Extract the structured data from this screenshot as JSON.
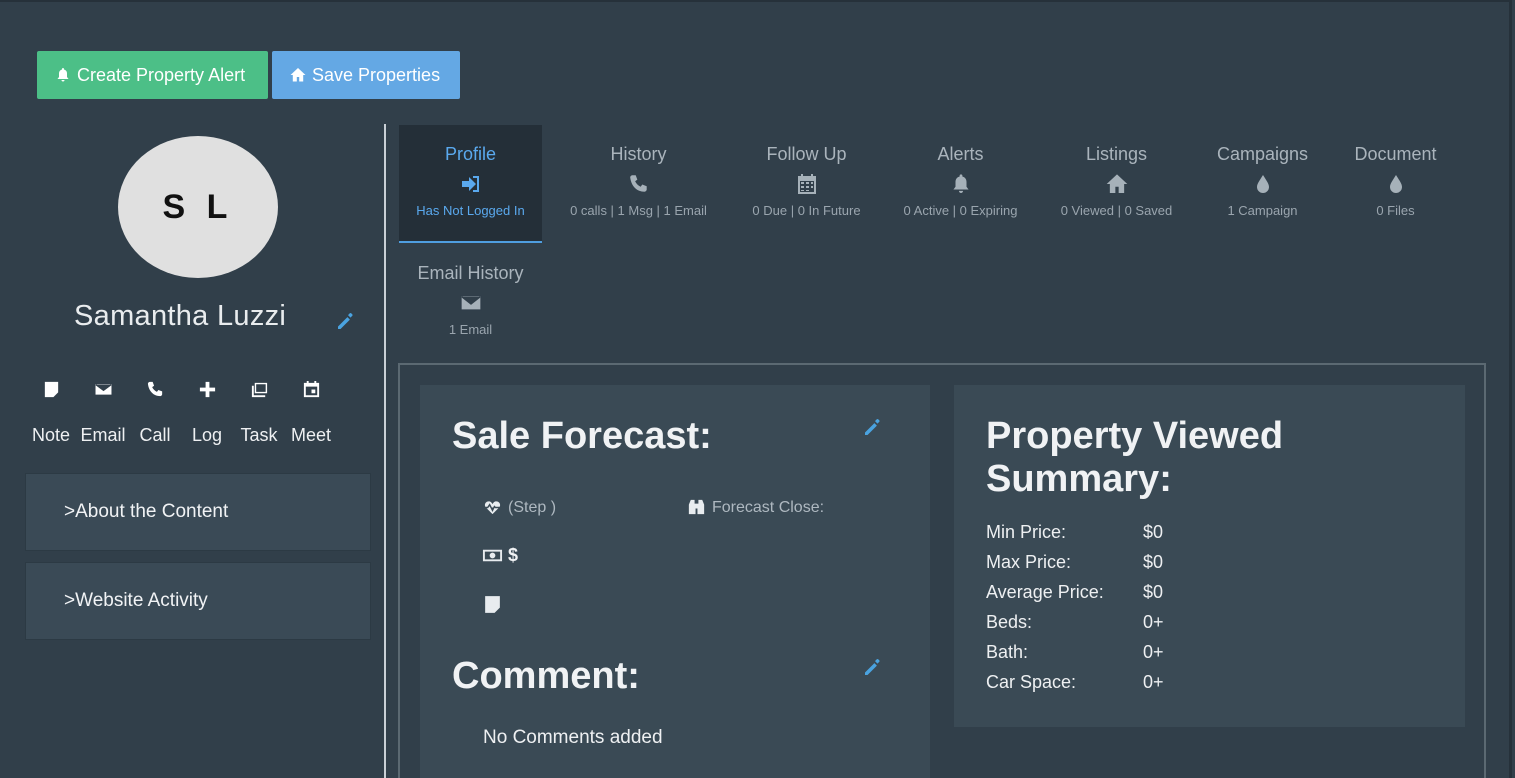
{
  "top_buttons": {
    "create_alert": "Create Property Alert",
    "save_properties": "Save Properties"
  },
  "contact": {
    "initials": "S L",
    "name": "Samantha Luzzi"
  },
  "actions": [
    {
      "label": "Note",
      "icon": "note-icon"
    },
    {
      "label": "Email",
      "icon": "envelope-icon"
    },
    {
      "label": "Call",
      "icon": "phone-icon"
    },
    {
      "label": "Log",
      "icon": "plus-icon"
    },
    {
      "label": "Task",
      "icon": "task-icon"
    },
    {
      "label": "Meet",
      "icon": "calendar-icon"
    }
  ],
  "accordions": [
    {
      "label": "About the Content"
    },
    {
      "label": "Website Activity"
    }
  ],
  "tabs": [
    {
      "label": "Profile",
      "sub": "Has Not Logged In",
      "icon": "sign-in-icon",
      "active": true
    },
    {
      "label": "History",
      "sub": "0 calls | 1 Msg | 1 Email",
      "icon": "phone-icon"
    },
    {
      "label": "Follow Up",
      "sub": "0 Due | 0 In Future",
      "icon": "calendar-icon"
    },
    {
      "label": "Alerts",
      "sub": "0 Active | 0 Expiring",
      "icon": "bell-icon"
    },
    {
      "label": "Listings",
      "sub": "0 Viewed | 0 Saved",
      "icon": "home-icon"
    },
    {
      "label": "Campaigns",
      "sub": "1 Campaign",
      "icon": "drop-icon"
    },
    {
      "label": "Document",
      "sub": "0 Files",
      "icon": "drop-icon"
    },
    {
      "label": "Email History",
      "sub": "1 Email",
      "icon": "envelope-icon"
    }
  ],
  "forecast": {
    "title": "Sale Forecast:",
    "step": "(Step )",
    "forecast_close": "Forecast Close:",
    "amount": "$"
  },
  "comment": {
    "title": "Comment:",
    "empty": "No Comments added"
  },
  "property_summary": {
    "title_line1": "Property Viewed",
    "title_line2": "Summary:",
    "rows": [
      {
        "key": "Min Price:",
        "value": "$0"
      },
      {
        "key": "Max Price:",
        "value": "$0"
      },
      {
        "key": "Average Price:",
        "value": "$0"
      },
      {
        "key": "Beds:",
        "value": "0+"
      },
      {
        "key": "Bath:",
        "value": "0+"
      },
      {
        "key": "Car Space:",
        "value": "0+"
      }
    ]
  },
  "colors": {
    "background": "#313f4a",
    "green_button": "#4cbf87",
    "blue_button": "#64a8e4",
    "accent": "#5aa9ee"
  }
}
